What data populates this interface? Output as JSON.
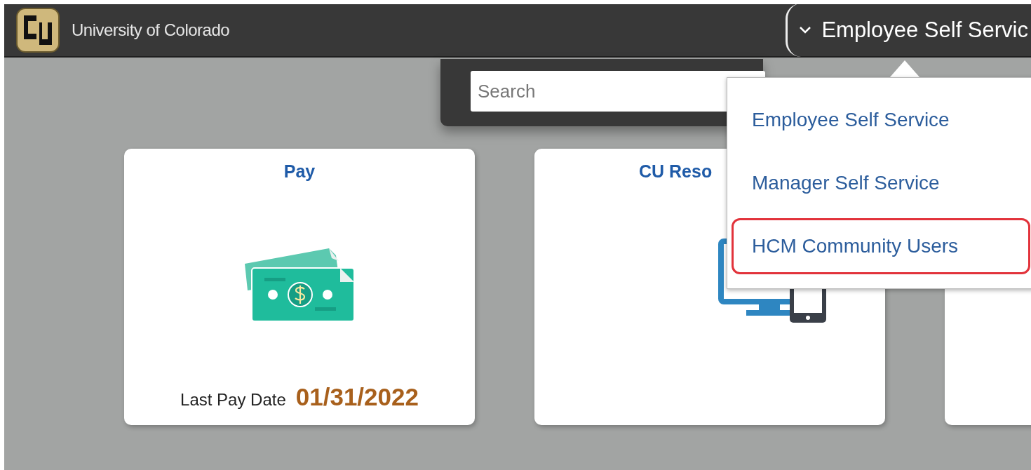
{
  "header": {
    "logo_text": "University of Colorado",
    "homepage_title": "Employee Self Servic"
  },
  "search": {
    "placeholder": "Search"
  },
  "tiles": [
    {
      "kind": "pay",
      "title": "Pay",
      "detail_label": "Last Pay Date",
      "detail_value": "01/31/2022"
    },
    {
      "kind": "resources",
      "title": "CU Reso",
      "clipped": true
    },
    {
      "kind": "blank"
    }
  ],
  "homepage_menu": {
    "items": [
      {
        "label": "Employee Self Service",
        "highlighted": false
      },
      {
        "label": "Manager Self Service",
        "highlighted": false
      },
      {
        "label": "HCM Community Users",
        "highlighted": true
      }
    ]
  }
}
